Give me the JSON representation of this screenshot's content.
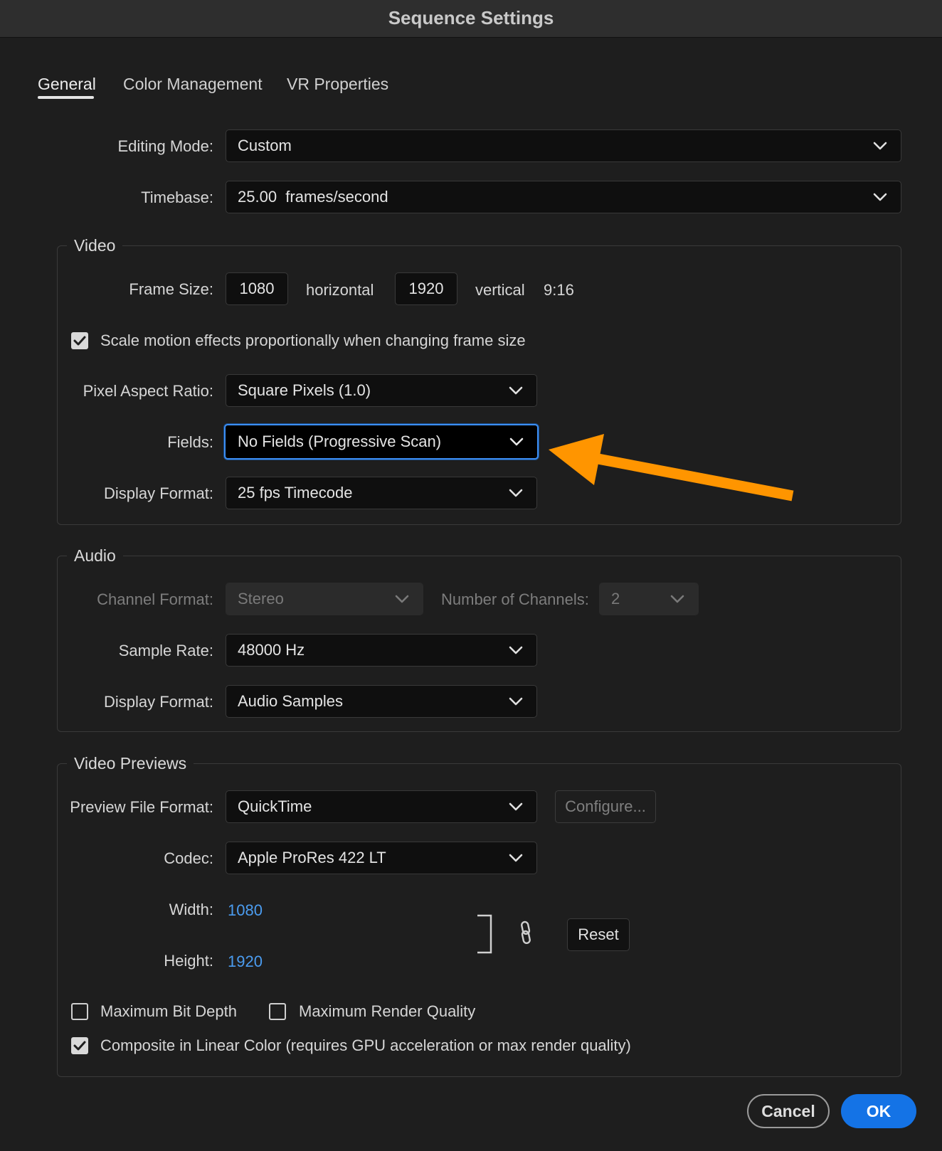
{
  "window": {
    "title": "Sequence Settings"
  },
  "tabs": [
    {
      "label": "General",
      "active": true
    },
    {
      "label": "Color Management",
      "active": false
    },
    {
      "label": "VR Properties",
      "active": false
    }
  ],
  "general": {
    "editing_mode": {
      "label": "Editing Mode:",
      "value": "Custom"
    },
    "timebase": {
      "label": "Timebase:",
      "value": "25.00  frames/second"
    }
  },
  "video": {
    "legend": "Video",
    "frame_size": {
      "label": "Frame Size:",
      "horizontal": "1080",
      "horizontal_label": "horizontal",
      "vertical": "1920",
      "vertical_label": "vertical",
      "aspect": "9:16"
    },
    "scale_motion": {
      "label": "Scale motion effects proportionally when changing frame size",
      "checked": true
    },
    "pixel_aspect": {
      "label": "Pixel Aspect Ratio:",
      "value": "Square Pixels (1.0)"
    },
    "fields": {
      "label": "Fields:",
      "value": "No Fields (Progressive Scan)"
    },
    "display_format": {
      "label": "Display Format:",
      "value": "25 fps Timecode"
    }
  },
  "audio": {
    "legend": "Audio",
    "channel_format": {
      "label": "Channel Format:",
      "value": "Stereo",
      "disabled": true
    },
    "num_channels": {
      "label": "Number of Channels:",
      "value": "2",
      "disabled": true
    },
    "sample_rate": {
      "label": "Sample Rate:",
      "value": "48000 Hz"
    },
    "display_format": {
      "label": "Display Format:",
      "value": "Audio Samples"
    }
  },
  "previews": {
    "legend": "Video Previews",
    "file_format": {
      "label": "Preview File Format:",
      "value": "QuickTime"
    },
    "configure_label": "Configure...",
    "codec": {
      "label": "Codec:",
      "value": "Apple ProRes 422 LT"
    },
    "width": {
      "label": "Width:",
      "value": "1080"
    },
    "height": {
      "label": "Height:",
      "value": "1920"
    },
    "reset_label": "Reset",
    "max_bit_depth": {
      "label": "Maximum Bit Depth",
      "checked": false
    },
    "max_render_quality": {
      "label": "Maximum Render Quality",
      "checked": false
    },
    "composite_linear": {
      "label": "Composite in Linear Color (requires GPU acceleration or max render quality)",
      "checked": true
    }
  },
  "footer": {
    "cancel_label": "Cancel",
    "ok_label": "OK"
  },
  "annotation": {
    "arrow_color": "#ff9500"
  },
  "colors": {
    "accent": "#1473e6",
    "focus_ring": "#3c8ef3",
    "link": "#4b9cf0"
  }
}
